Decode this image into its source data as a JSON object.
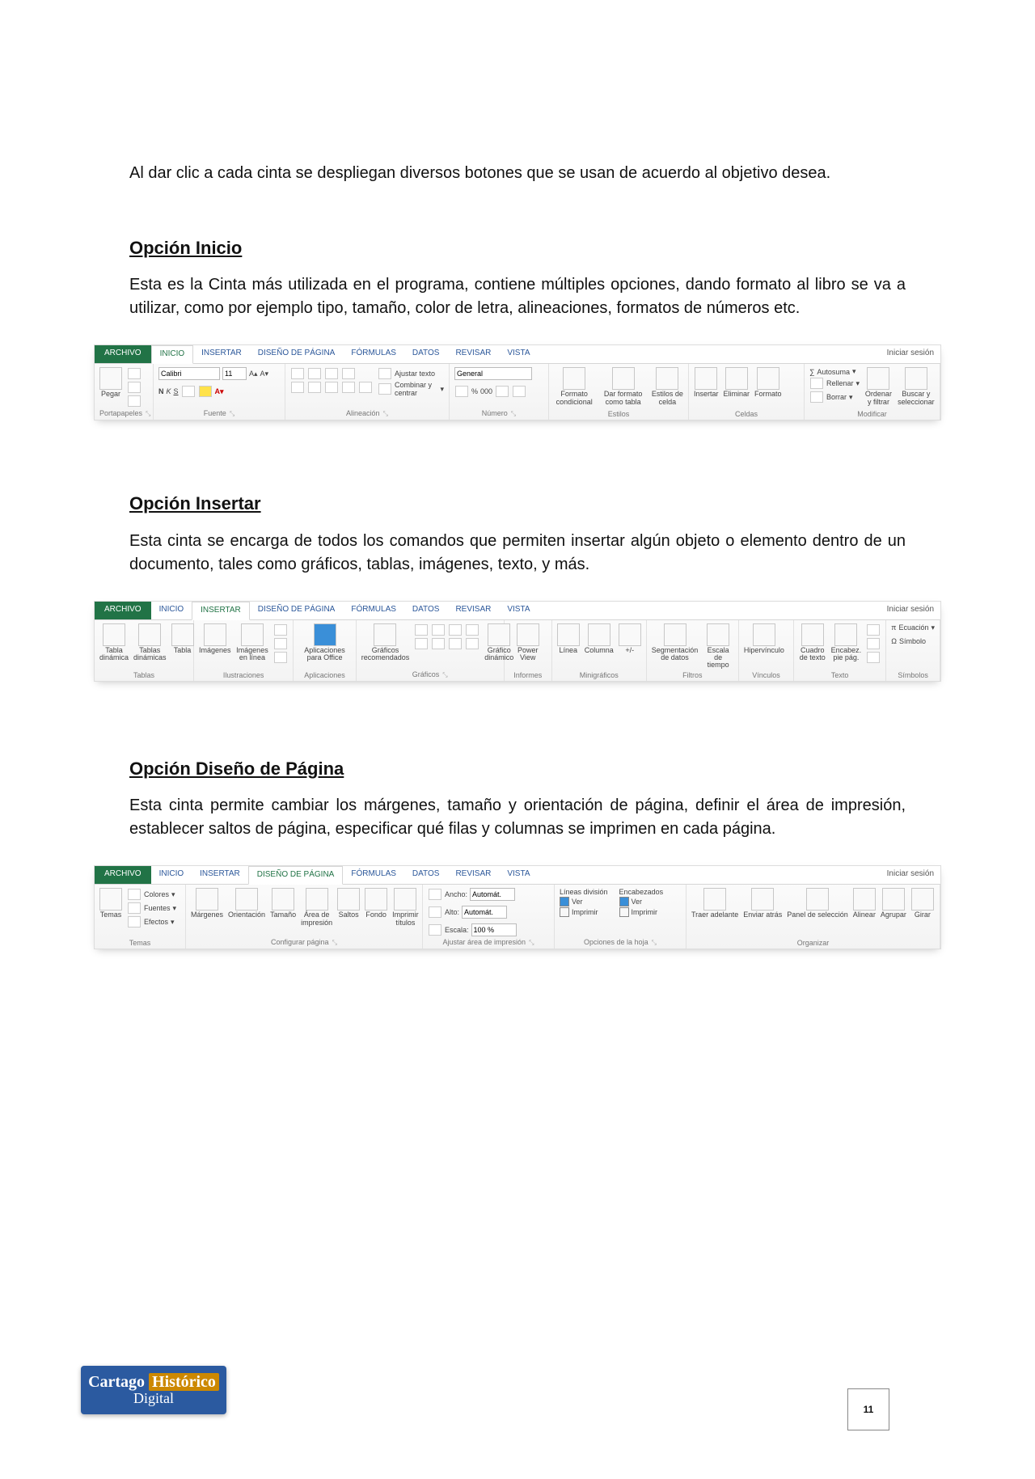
{
  "intro": "Al dar clic a cada cinta se despliegan diversos botones que se usan de acuerdo al objetivo desea.",
  "sections": {
    "inicio": {
      "heading": "Opción Inicio",
      "body": "Esta es la Cinta más utilizada en el programa, contiene múltiples opciones, dando formato al libro se va a utilizar, como por ejemplo tipo, tamaño, color de letra, alineaciones, formatos de números etc."
    },
    "insertar": {
      "heading": "Opción Insertar",
      "body": "Esta cinta se encarga de todos los comandos que permiten insertar algún objeto o elemento dentro de un documento, tales como gráficos, tablas, imágenes, texto, y más."
    },
    "diseno": {
      "heading": "Opción Diseño de Página",
      "body": "Esta cinta permite cambiar los márgenes, tamaño y orientación de página, definir el área de impresión, establecer saltos de página, especificar qué filas y columnas se imprimen en cada página."
    }
  },
  "tabs": {
    "archivo": "ARCHIVO",
    "inicio": "INICIO",
    "insertar": "INSERTAR",
    "diseno": "DISEÑO DE PÁGINA",
    "formulas": "FÓRMULAS",
    "datos": "DATOS",
    "revisar": "REVISAR",
    "vista": "VISTA",
    "signin": "Iniciar sesión"
  },
  "ribbon_inicio": {
    "portapapeles": {
      "label": "Portapapeles",
      "pegar": "Pegar"
    },
    "fuente": {
      "label": "Fuente",
      "font": "Calibri",
      "size": "11",
      "bold": "N",
      "italic": "K",
      "underline": "S"
    },
    "alineacion": {
      "label": "Alineación",
      "ajustar": "Ajustar texto",
      "combinar": "Combinar y centrar"
    },
    "numero": {
      "label": "Número",
      "format": "General"
    },
    "estilos": {
      "label": "Estilos",
      "cond": "Formato\ncondicional",
      "tabla": "Dar formato\ncomo tabla",
      "celda": "Estilos de\ncelda"
    },
    "celdas": {
      "label": "Celdas",
      "insertar": "Insertar",
      "eliminar": "Eliminar",
      "formato": "Formato"
    },
    "modificar": {
      "label": "Modificar",
      "autosuma": "Autosuma",
      "rellenar": "Rellenar",
      "borrar": "Borrar",
      "ordenar": "Ordenar\ny filtrar",
      "buscar": "Buscar y\nseleccionar"
    }
  },
  "ribbon_insertar": {
    "tablas": {
      "label": "Tablas",
      "dinamica": "Tabla\ndinámica",
      "dinamicas": "Tablas\ndinámicas",
      "tabla": "Tabla"
    },
    "ilustraciones": {
      "label": "Ilustraciones",
      "imagenes": "Imágenes",
      "enlinea": "Imágenes\nen línea"
    },
    "aplicaciones": {
      "label": "Aplicaciones",
      "apps": "Aplicaciones\npara Office"
    },
    "graficos": {
      "label": "Gráficos",
      "recomendados": "Gráficos\nrecomendados",
      "dinamico": "Gráfico\ndinámico"
    },
    "informes": {
      "label": "Informes",
      "power": "Power\nView"
    },
    "minigraficos": {
      "label": "Minigráficos",
      "linea": "Línea",
      "columna": "Columna",
      "pm": "+/-"
    },
    "filtros": {
      "label": "Filtros",
      "segmentacion": "Segmentación\nde datos",
      "escala": "Escala de\ntiempo"
    },
    "vinculos": {
      "label": "Vínculos",
      "hiper": "Hipervínculo"
    },
    "texto": {
      "label": "Texto",
      "cuadro": "Cuadro\nde texto",
      "encabez": "Encabez.\npie pág."
    },
    "simbolos": {
      "label": "Símbolos",
      "ecuacion": "Ecuación",
      "simbolo": "Símbolo"
    }
  },
  "ribbon_diseno": {
    "temas": {
      "label": "Temas",
      "temas": "Temas",
      "colores": "Colores",
      "fuentes": "Fuentes",
      "efectos": "Efectos"
    },
    "configurar": {
      "label": "Configurar página",
      "margenes": "Márgenes",
      "orientacion": "Orientación",
      "tamano": "Tamaño",
      "area": "Área de\nimpresión",
      "saltos": "Saltos",
      "fondo": "Fondo",
      "imprimir_titulos": "Imprimir\ntítulos"
    },
    "ajustar": {
      "label": "Ajustar área de impresión",
      "ancho": "Ancho:",
      "alto": "Alto:",
      "escala": "Escala:",
      "automat": "Automát.",
      "escala_val": "100 %"
    },
    "opciones": {
      "label": "Opciones de la hoja",
      "lineas": "Líneas división",
      "encabezados": "Encabezados",
      "ver": "Ver",
      "imprimir": "Imprimir"
    },
    "organizar": {
      "label": "Organizar",
      "traer": "Traer\nadelante",
      "enviar": "Enviar\natrás",
      "panel": "Panel de\nselección",
      "alinear": "Alinear",
      "agrupar": "Agrupar",
      "girar": "Girar"
    }
  },
  "footer": {
    "logo1": "Cartago",
    "logo1b": "Histórico",
    "logo2": "Digital",
    "page": "11"
  }
}
